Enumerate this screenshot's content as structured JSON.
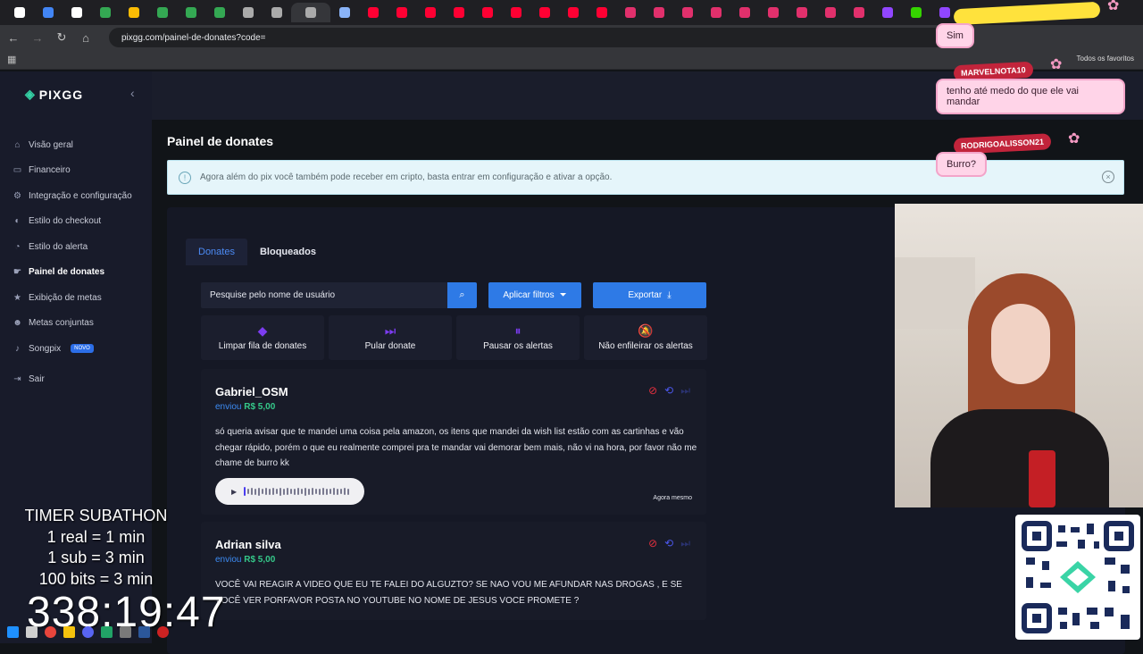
{
  "browser": {
    "url": "pixgg.com/painel-de-donates?code=",
    "bookmarks_label": "Todos os favoritos",
    "tab_favicon_colors": [
      "#ffffff",
      "#4285f4",
      "#ffffff",
      "#34a853",
      "#fbbc04",
      "#34a853",
      "#34a853",
      "#34a853",
      "#aaaaaa",
      "#aaaaaa",
      "#aaaaaa",
      "#8ab4f8",
      "#ff0033",
      "#ff0033",
      "#ff0033",
      "#ff0033",
      "#ff0033",
      "#ff0033",
      "#ff0033",
      "#ff0033",
      "#ff0033",
      "#e1306c",
      "#e1306c",
      "#e1306c",
      "#e1306c",
      "#e1306c",
      "#e1306c",
      "#e1306c",
      "#e1306c",
      "#e1306c",
      "#9146ff",
      "#35d300",
      "#9146ff"
    ]
  },
  "sidebar": {
    "logo": "PIXGG",
    "items": [
      {
        "label": "Visão geral",
        "icon": "home-icon"
      },
      {
        "label": "Financeiro",
        "icon": "wallet-icon"
      },
      {
        "label": "Integração e configuração",
        "icon": "gear-icon"
      },
      {
        "label": "Estilo do checkout",
        "icon": "palette-icon"
      },
      {
        "label": "Estilo do alerta",
        "icon": "bell-icon"
      },
      {
        "label": "Painel de donates",
        "icon": "hand-icon",
        "active": true
      },
      {
        "label": "Exibição de metas",
        "icon": "star-icon"
      },
      {
        "label": "Metas conjuntas",
        "icon": "people-icon"
      },
      {
        "label": "Songpix",
        "icon": "music-icon",
        "badge": "NOVO"
      },
      {
        "label": "Sair",
        "icon": "logout-icon"
      }
    ]
  },
  "main": {
    "title": "Painel de donates",
    "info": "Agora além do pix você também pode receber em cripto, basta entrar em configuração e ativar a opção.",
    "tabs": [
      "Donates",
      "Bloqueados"
    ],
    "search_placeholder": "Pesquise pelo nome de usuário",
    "apply_filters": "Aplicar filtros",
    "export": "Exportar",
    "actions": [
      {
        "label": "Limpar fila de donates",
        "icon": "eraser-icon"
      },
      {
        "label": "Pular donate",
        "icon": "skip-icon"
      },
      {
        "label": "Pausar os alertas",
        "icon": "pause-icon"
      },
      {
        "label": "Não enfileirar os alertas",
        "icon": "bell-off-icon"
      }
    ],
    "donates": [
      {
        "name": "Gabriel_OSM",
        "sent_label": "enviou",
        "amount": "R$ 5,00",
        "message": "só queria avisar que te mandei uma coisa pela amazon, os itens que mandei da wish list estão com as cartinhas e vão chegar rápido, porém o que eu realmente comprei pra te mandar vai demorar bem mais, não vi na hora, por favor não me chame de burro kk",
        "time": "Agora mesmo"
      },
      {
        "name": "Adrian silva",
        "sent_label": "enviou",
        "amount": "R$ 5,00",
        "message": "VOCÊ VAI REAGIR A VIDEO QUE EU TE FALEI DO ALGUZTO? SE NAO VOU ME AFUNDAR NAS DROGAS , E SE VOCÊ VER PORFAVOR POSTA NO YOUTUBE NO NOME DE JESUS VOCE PROMETE ?"
      }
    ]
  },
  "overlay": {
    "chat": [
      {
        "name": "",
        "message": "Sim"
      },
      {
        "name": "MARVELNOTA10",
        "message": "tenho até medo do que ele vai mandar"
      },
      {
        "name": "RODRIGOALISSON21",
        "message": "Burro?"
      }
    ],
    "timer_title": "TIMER SUBATHON",
    "timer_lines": [
      "1 real = 1 min",
      "1 sub = 3 min",
      "100 bits = 3 min"
    ],
    "timer_value": "338:19:47"
  }
}
